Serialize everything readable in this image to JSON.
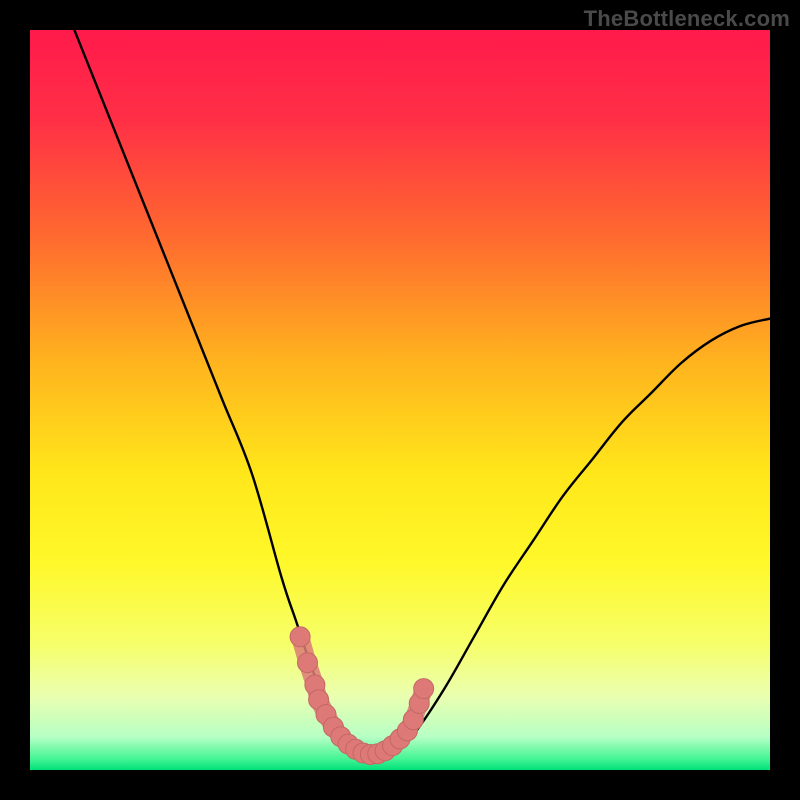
{
  "watermark": "TheBottleneck.com",
  "colors": {
    "frame": "#000000",
    "gradient_stops": [
      {
        "offset": 0.0,
        "color": "#ff1a4b"
      },
      {
        "offset": 0.12,
        "color": "#ff2f46"
      },
      {
        "offset": 0.28,
        "color": "#ff6a2f"
      },
      {
        "offset": 0.45,
        "color": "#ffb41e"
      },
      {
        "offset": 0.6,
        "color": "#ffe71a"
      },
      {
        "offset": 0.72,
        "color": "#fff82a"
      },
      {
        "offset": 0.83,
        "color": "#f6ff6a"
      },
      {
        "offset": 0.9,
        "color": "#eaffb0"
      },
      {
        "offset": 0.955,
        "color": "#b7ffc4"
      },
      {
        "offset": 0.985,
        "color": "#44f594"
      },
      {
        "offset": 1.0,
        "color": "#00e07a"
      }
    ],
    "curve": "#000000",
    "marker_fill": "#dd7a78",
    "marker_stroke": "#c46765"
  },
  "chart_data": {
    "type": "line",
    "title": "",
    "xlabel": "",
    "ylabel": "",
    "xlim": [
      0,
      100
    ],
    "ylim": [
      0,
      100
    ],
    "grid": false,
    "legend": false,
    "series": [
      {
        "name": "bottleneck-curve",
        "x": [
          6,
          10,
          14,
          18,
          22,
          26,
          30,
          34,
          36,
          38,
          40,
          42,
          44,
          46,
          48,
          50,
          52,
          56,
          60,
          64,
          68,
          72,
          76,
          80,
          84,
          88,
          92,
          96,
          100
        ],
        "y": [
          100,
          90,
          80,
          70,
          60,
          50,
          40,
          26,
          20,
          14,
          9,
          5,
          3,
          2,
          2,
          3,
          5,
          11,
          18,
          25,
          31,
          37,
          42,
          47,
          51,
          55,
          58,
          60,
          61
        ]
      }
    ],
    "markers": {
      "name": "highlight-band",
      "x": [
        36.5,
        37.5,
        38.5,
        39.0,
        40.0,
        41.0,
        42.0,
        43.0,
        44.0,
        45.0,
        46.0,
        47.0,
        48.0,
        49.0,
        50.0,
        51.0,
        51.8,
        52.6,
        53.2
      ],
      "y": [
        18.0,
        14.5,
        11.5,
        9.5,
        7.5,
        5.8,
        4.5,
        3.5,
        2.8,
        2.3,
        2.1,
        2.2,
        2.6,
        3.3,
        4.2,
        5.3,
        6.8,
        9.0,
        11.0
      ]
    }
  }
}
